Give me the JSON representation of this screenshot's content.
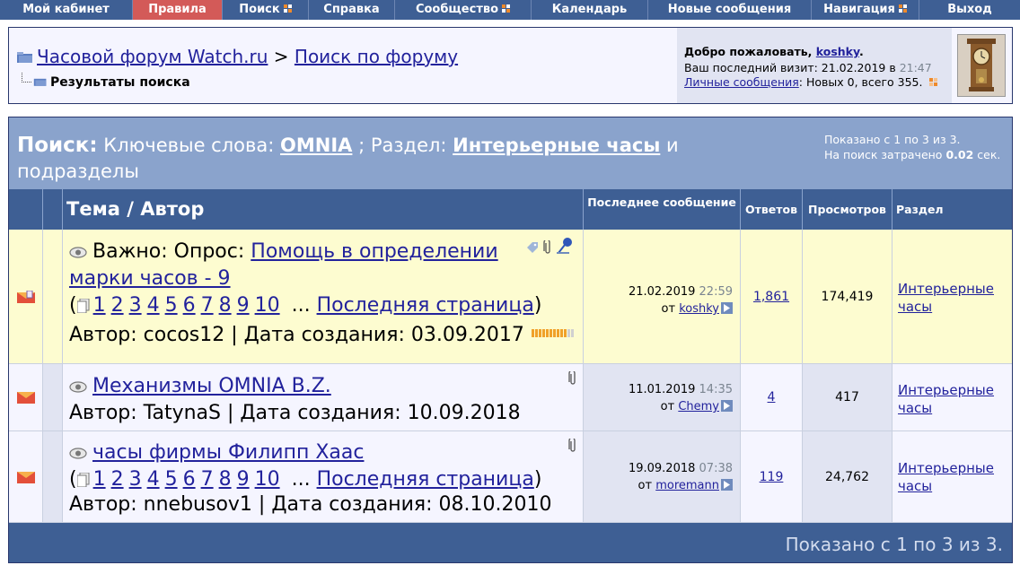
{
  "nav": {
    "items": [
      {
        "label": "Мой кабинет",
        "w": 148,
        "arrow": false
      },
      {
        "label": "Правила",
        "w": 100,
        "arrow": false,
        "active": true
      },
      {
        "label": "Поиск",
        "w": 96,
        "arrow": true
      },
      {
        "label": "Справка",
        "w": 96,
        "arrow": false
      },
      {
        "label": "Сообщество",
        "w": 152,
        "arrow": true
      },
      {
        "label": "Календарь",
        "w": 130,
        "arrow": false
      },
      {
        "label": "Новые сообщения",
        "w": 182,
        "arrow": false
      },
      {
        "label": "Навигация",
        "w": 120,
        "arrow": true
      },
      {
        "label": "Выход",
        "w": 112,
        "arrow": false
      }
    ]
  },
  "breadcrumb": {
    "forum": "Часовой форум Watch.ru",
    "sep": ">",
    "section": "Поиск по форуму",
    "current": "Результаты поиска"
  },
  "welcome": {
    "greeting": "Добро пожаловать,",
    "user": "koshky",
    "last_visit_label": "Ваш последний визит: 21.02.2019 в",
    "last_visit_time": "21:47",
    "pm_link": "Личные сообщения",
    "pm_counts": ": Новых 0, всего 355."
  },
  "search": {
    "label": "Поиск:",
    "keywords_label": "Ключевые слова:",
    "keyword": "OMNIA",
    "section_label": "; Раздел:",
    "section": "Интерьерные часы",
    "suffix": "и подразделы",
    "shown": "Показано с 1 по 3 из 3.",
    "time_label": "На поиск затрачено",
    "time_value": "0.02",
    "time_unit": "сек."
  },
  "columns": {
    "topic": "Тема / Автор",
    "last": "Последнее сообщение",
    "replies": "Ответов",
    "views": "Просмотров",
    "forum": "Раздел"
  },
  "rows": [
    {
      "prefix": "Важно: Опрос:",
      "title": "Помощь в определении марки часов - 9",
      "pages": [
        "1",
        "2",
        "3",
        "4",
        "5",
        "6",
        "7",
        "8",
        "9",
        "10"
      ],
      "last_page": "Последняя страница",
      "author": "Автор: cocos12 | Дата создания: 03.09.2017",
      "last_date": "21.02.2019",
      "last_time": "22:59",
      "last_by": "koshky",
      "replies": "1,861",
      "views": "174,419",
      "forum": "Интерьерные часы",
      "rating": 10
    },
    {
      "prefix": "",
      "title": "Механизмы OMNIA B.Z.",
      "pages": [],
      "last_page": "",
      "author": "Автор: TatynaS | Дата создания: 10.09.2018",
      "last_date": "11.01.2019",
      "last_time": "14:35",
      "last_by": "Chemy",
      "replies": "4",
      "views": "417",
      "forum": "Интерьерные часы"
    },
    {
      "prefix": "",
      "title": "часы фирмы Филипп Хаас",
      "pages": [
        "1",
        "2",
        "3",
        "4",
        "5",
        "6",
        "7",
        "8",
        "9",
        "10"
      ],
      "last_page": "Последняя страница",
      "author": "Автор: nnebusov1 | Дата создания: 08.10.2010",
      "last_date": "19.09.2018",
      "last_time": "07:38",
      "last_by": "moremann",
      "replies": "119",
      "views": "24,762",
      "forum": "Интерьерные часы"
    }
  ],
  "footer": {
    "shown": "Показано с 1 по 3 из 3."
  },
  "colors": {
    "nav": "#3e5f94",
    "active": "#d35a58",
    "header_light": "#8aa3cc",
    "highlight_row": "#fdfcd0",
    "link": "#22229c"
  }
}
